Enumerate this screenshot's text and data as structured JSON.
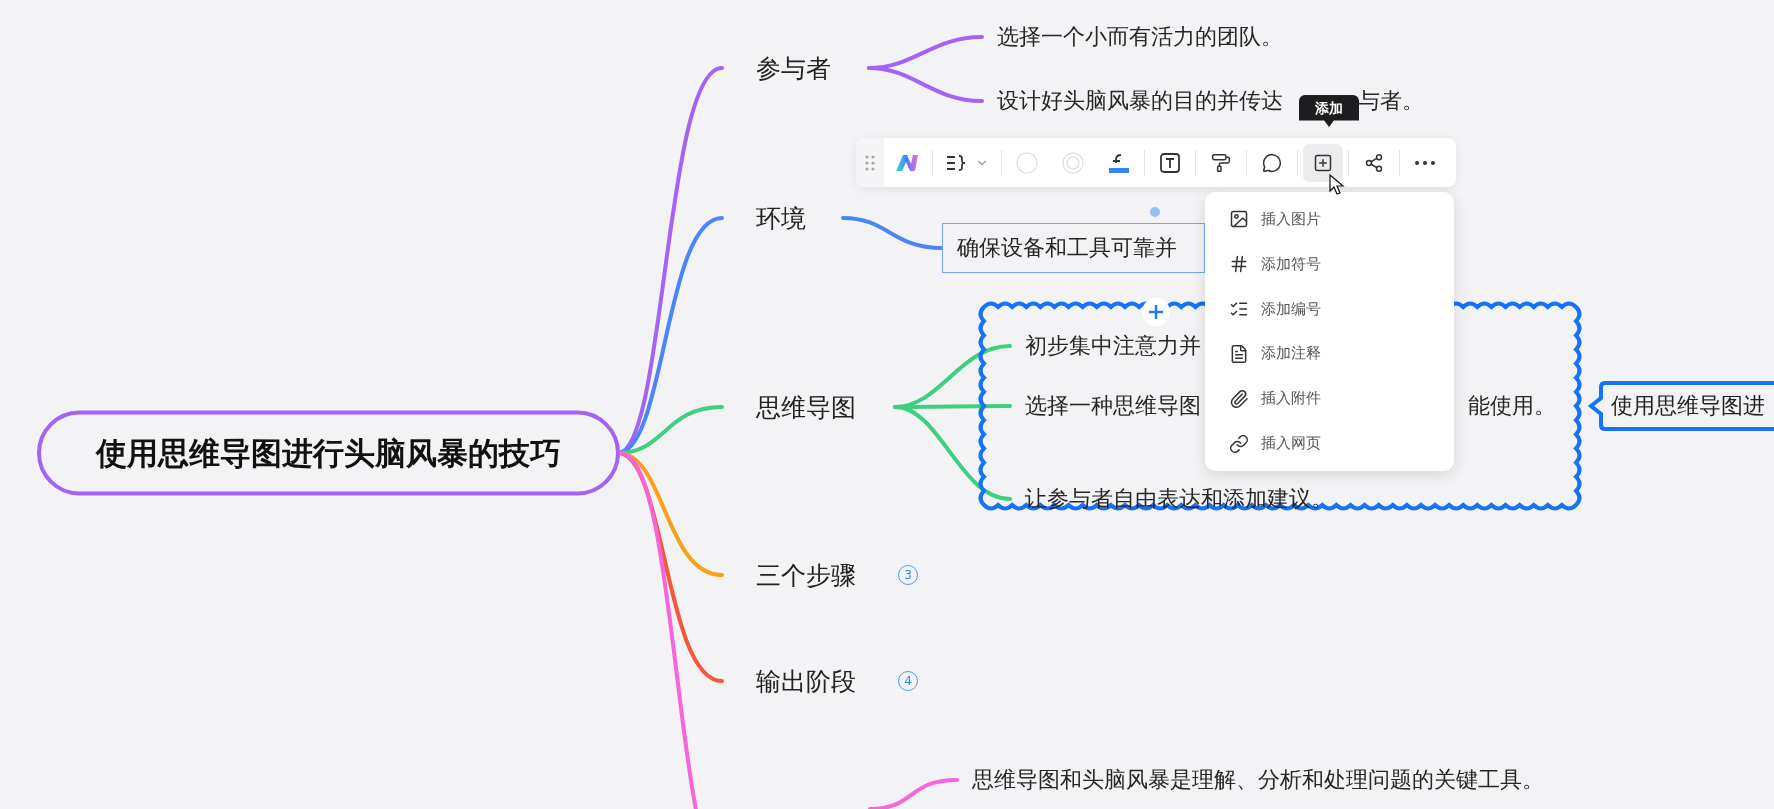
{
  "root": {
    "text": "使用思维导图进行头脑风暴的技巧"
  },
  "branches": [
    {
      "label": "参与者",
      "color": "#a364f4",
      "children": [
        {
          "text": "选择一个小而有活力的团队。",
          "selected": false
        },
        {
          "text": "设计好头脑风暴的目的并传达",
          "text_tail": "与者。",
          "selected": false
        }
      ]
    },
    {
      "label": "环境",
      "color": "#4a86f7",
      "children": [
        {
          "text": "确保设备和工具可靠并",
          "selected": true
        }
      ]
    },
    {
      "label": "思维导图",
      "color": "#3ecf80",
      "boundary": {
        "selected": true
      },
      "children": [
        {
          "text": "初步集中注意力并",
          "selected": false
        },
        {
          "text": "选择一种思维导图",
          "text_tail": "能使用。",
          "selected": false
        },
        {
          "text": "让参与者自由表达和添加建议。",
          "selected": false
        }
      ],
      "summary": {
        "text": "使用思维导图进"
      }
    },
    {
      "label": "三个步骤",
      "color": "#f6a21d",
      "collapsed_count": "3"
    },
    {
      "label": "输出阶段",
      "color": "#f5563c",
      "collapsed_count": "4"
    },
    {
      "color": "#f765d9",
      "children": [
        {
          "text": "思维导图和头脑风暴是理解、分析和处理问题的关键工具。",
          "selected": false
        }
      ]
    }
  ],
  "toolbar": {
    "buttons": [
      {
        "selected": false
      },
      {
        "selected": false
      },
      {
        "selected": false
      },
      {
        "selected": false
      },
      {
        "selected": false
      },
      {
        "selected": false
      },
      {
        "selected": false
      },
      {
        "selected": false
      },
      {
        "selected": true
      },
      {
        "selected": false
      },
      {
        "selected": false
      }
    ]
  },
  "tooltip": {
    "text": "添加"
  },
  "menu": {
    "items": [
      {
        "label": "插入图片"
      },
      {
        "label": "添加符号"
      },
      {
        "label": "添加编号"
      },
      {
        "label": "添加注释"
      },
      {
        "label": "插入附件"
      },
      {
        "label": "插入网页"
      }
    ]
  }
}
